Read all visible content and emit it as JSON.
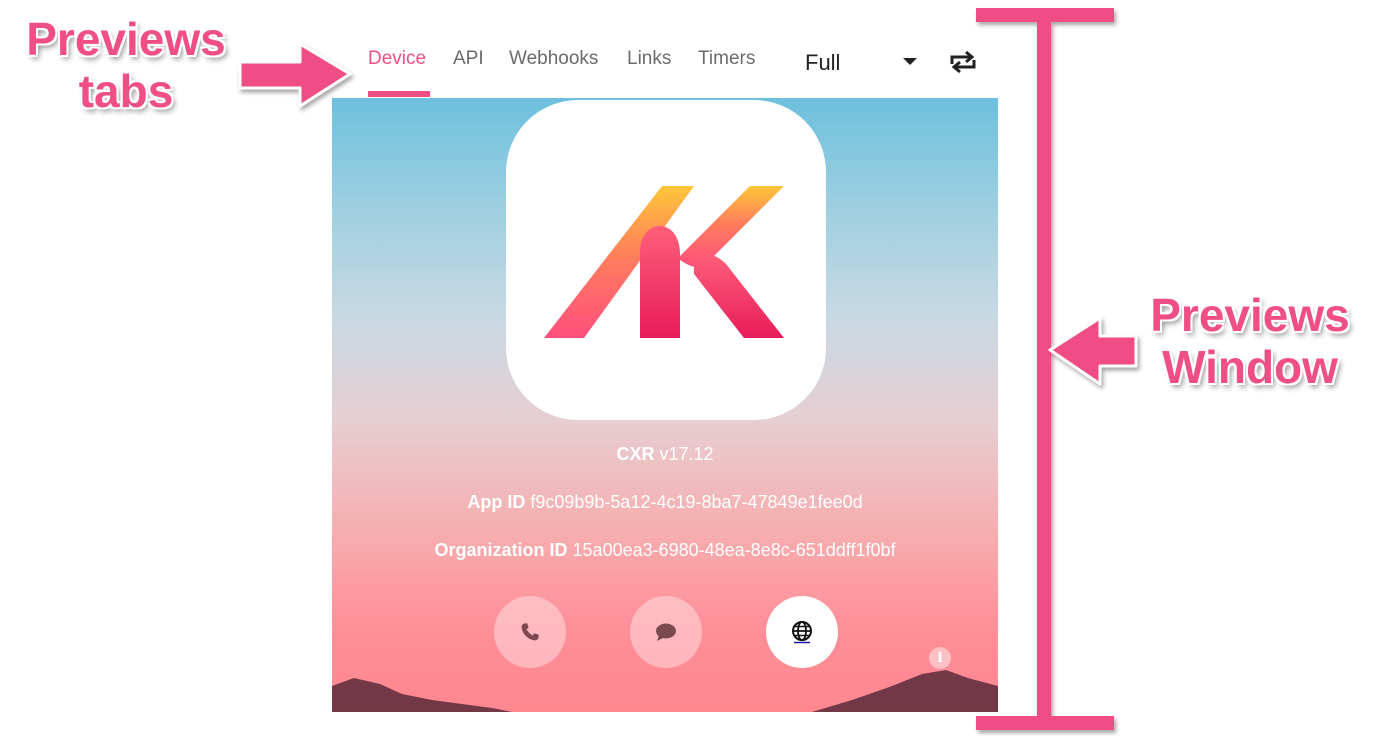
{
  "annotations": {
    "tabs_callout": [
      "Previews",
      "tabs"
    ],
    "window_callout": [
      "Previews",
      "Window"
    ]
  },
  "tabs": [
    {
      "label": "Device",
      "active": true
    },
    {
      "label": "API",
      "active": false
    },
    {
      "label": "Webhooks",
      "active": false
    },
    {
      "label": "Links",
      "active": false
    },
    {
      "label": "Timers",
      "active": false
    }
  ],
  "view_select": {
    "value": "Full"
  },
  "rotate_icon": "rotate-icon",
  "preview": {
    "app_name": "CXR",
    "version": "v17.12",
    "app_id_label": "App ID",
    "app_id": "f9c09b9b-5a12-4c19-8ba7-47849e1fee0d",
    "org_id_label": "Organization ID",
    "org_id": "15a00ea3-6980-48ea-8e8c-651ddff1f0bf",
    "buttons": [
      "phone-icon",
      "chat-icon",
      "globe-icon"
    ],
    "info_glyph": "i"
  },
  "colors": {
    "accent": "#f04e86",
    "tab_text": "#6b6b6b",
    "sky_top": "#6cc0de",
    "sky_bottom": "#ff8790"
  }
}
